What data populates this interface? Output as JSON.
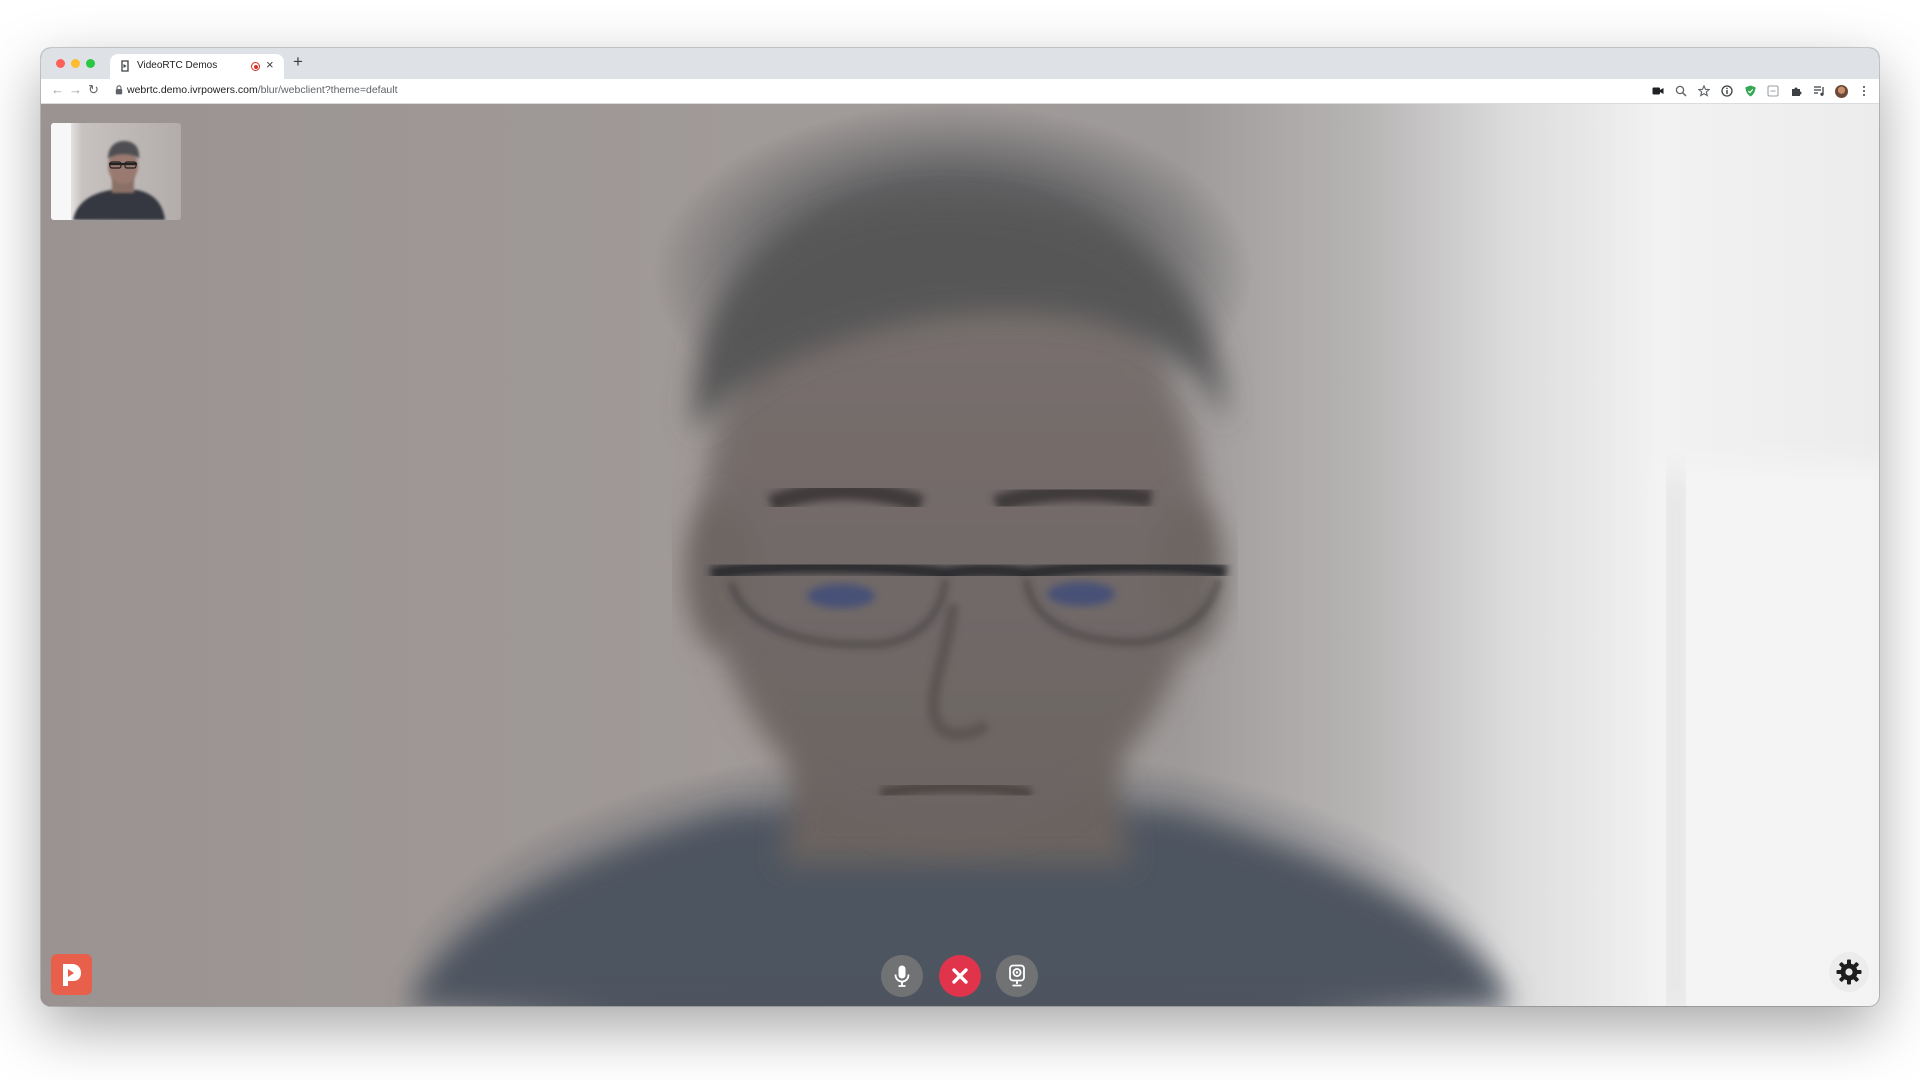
{
  "browser": {
    "tab": {
      "title": "VideoRTC Demos",
      "close_glyph": "×",
      "favicon_icon": "page-icon",
      "recording_icon": "recording-indicator-icon"
    },
    "new_tab_glyph": "+",
    "nav": {
      "back_glyph": "←",
      "forward_glyph": "→",
      "reload_glyph": "↻"
    },
    "address": {
      "host": "webrtc.demo.ivrpowers.com",
      "path": "/blur/webclient?theme=default"
    },
    "toolbar_icons": [
      "camera-icon",
      "zoom-icon",
      "bookmark-star-icon",
      "info-extension-icon",
      "shield-extension-icon",
      "extension-box-icon",
      "puzzle-extensions-icon",
      "media-queue-icon",
      "profile-avatar",
      "menu-kebab-icon"
    ]
  },
  "call": {
    "remote_video": "remote-video",
    "local_preview": "local-video-preview",
    "controls": {
      "mute_icon": "microphone-icon",
      "hangup_icon": "hangup-x-icon",
      "camera_icon": "webcam-icon"
    },
    "settings_icon": "gear-icon",
    "logo": "app-logo",
    "colors": {
      "hangup": "#e0334c",
      "logo": "#e8604c"
    }
  }
}
